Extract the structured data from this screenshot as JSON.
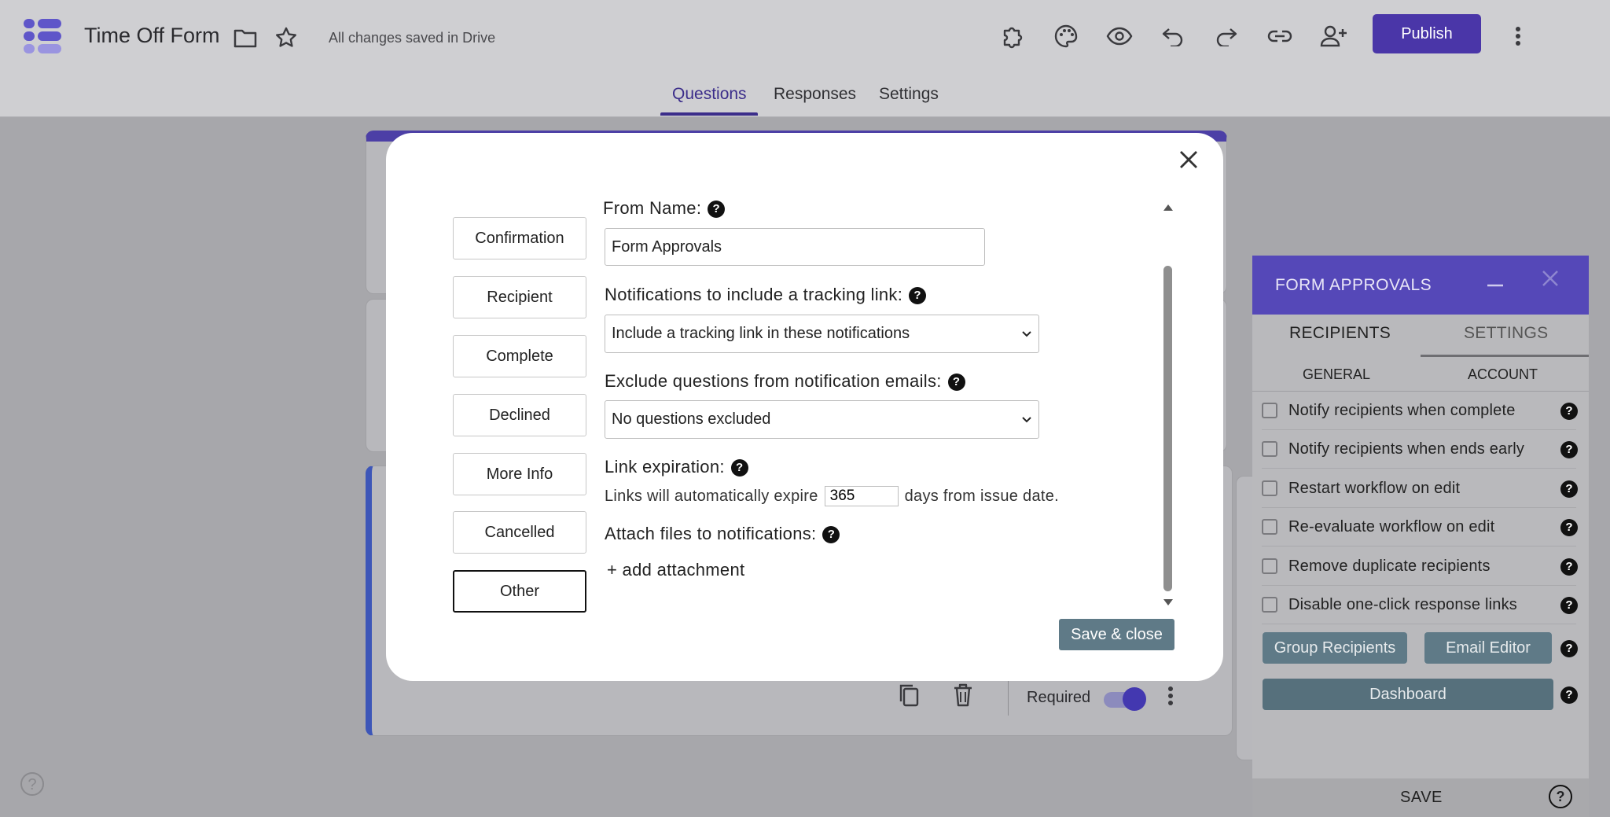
{
  "app": {
    "title": "Time Off Form",
    "save_status": "All changes saved in Drive",
    "publish_label": "Publish",
    "accent": "#4a36a8"
  },
  "tabs": [
    {
      "label": "Questions",
      "active": true
    },
    {
      "label": "Responses",
      "active": false
    },
    {
      "label": "Settings",
      "active": false
    }
  ],
  "modal": {
    "nav": [
      {
        "label": "Confirmation",
        "selected": false
      },
      {
        "label": "Recipient",
        "selected": false
      },
      {
        "label": "Complete",
        "selected": false
      },
      {
        "label": "Declined",
        "selected": false
      },
      {
        "label": "More Info",
        "selected": false
      },
      {
        "label": "Cancelled",
        "selected": false
      },
      {
        "label": "Other",
        "selected": true
      }
    ],
    "from_name_label": "From Name:",
    "from_name_value": "Form Approvals",
    "tracking_label": "Notifications to include a tracking link:",
    "tracking_value": "Include a tracking link in these notifications",
    "exclude_label": "Exclude questions from notification emails:",
    "exclude_value": "No questions excluded",
    "expiration_label": "Link expiration:",
    "expire_prefix": "Links will automatically expire",
    "expire_days": "365",
    "expire_suffix": "days from issue date.",
    "attach_label": "Attach files to notifications:",
    "add_attachment": "+ add attachment",
    "save_close": "Save & close",
    "help_glyph": "?"
  },
  "question_footer": {
    "required_label": "Required",
    "required_on": true
  },
  "panel": {
    "title": "FORM APPROVALS",
    "tabs": [
      {
        "label": "RECIPIENTS",
        "active": true
      },
      {
        "label": "SETTINGS",
        "active": false
      }
    ],
    "subtabs": [
      {
        "label": "GENERAL"
      },
      {
        "label": "ACCOUNT"
      }
    ],
    "options": [
      {
        "label": "Notify recipients when complete",
        "checked": false
      },
      {
        "label": "Notify recipients when ends early",
        "checked": false
      },
      {
        "label": "Restart workflow on edit",
        "checked": false
      },
      {
        "label": "Re-evaluate workflow on edit",
        "checked": false
      },
      {
        "label": "Remove duplicate recipients",
        "checked": false
      },
      {
        "label": "Disable one-click response links",
        "checked": false
      }
    ],
    "group_recipients": "Group Recipients",
    "email_editor": "Email Editor",
    "dashboard": "Dashboard",
    "save": "SAVE"
  },
  "icons": [
    "forms-logo-icon",
    "folder-icon",
    "star-icon",
    "addon-puzzle-icon",
    "palette-icon",
    "preview-eye-icon",
    "undo-icon",
    "redo-icon",
    "link-icon",
    "add-collaborator-icon",
    "more-vert-icon",
    "close-icon",
    "copy-icon",
    "delete-icon",
    "help-icon"
  ]
}
